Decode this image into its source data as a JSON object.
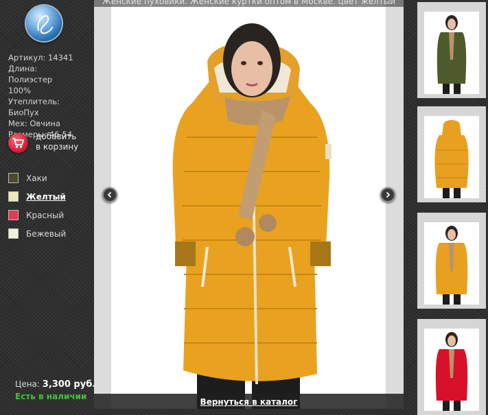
{
  "product": {
    "info_lines": [
      "Артикул: 14341",
      "Длина: Полиэстер",
      "100%",
      "Утеплитель:",
      "БиоПух",
      "Мех: Овчина",
      "Размеры: 46-54"
    ],
    "add_to_cart_line1": "добавить",
    "add_to_cart_line2": "в корзину",
    "colors": [
      {
        "label": "Хаки",
        "swatch": "#4b4b28",
        "active": false
      },
      {
        "label": "Желтый",
        "swatch": "#ece7b8",
        "active": true
      },
      {
        "label": "Красный",
        "swatch": "#e23a4f",
        "active": false
      },
      {
        "label": "Бежевый",
        "swatch": "#f1f1d8",
        "active": false
      }
    ],
    "price_label": "Цена:",
    "price_value": "3,300 руб.",
    "stock_status": "Есть в наличии"
  },
  "viewer": {
    "title": "Женские пуховики. Женские куртки оптом в Москве. цвет желтый",
    "back_link": "Вернуться в каталог"
  },
  "thumbnails": [
    {
      "color": "khaki",
      "hex": "#4e5a2c"
    },
    {
      "color": "yellow-back",
      "hex": "#e8a020"
    },
    {
      "color": "yellow",
      "hex": "#e8a020"
    },
    {
      "color": "red",
      "hex": "#d8112a"
    }
  ],
  "icons": {
    "logo": "brand-logo-icon",
    "cart": "shopping-cart-icon",
    "prev": "chevron-left-icon",
    "next": "chevron-right-icon"
  }
}
